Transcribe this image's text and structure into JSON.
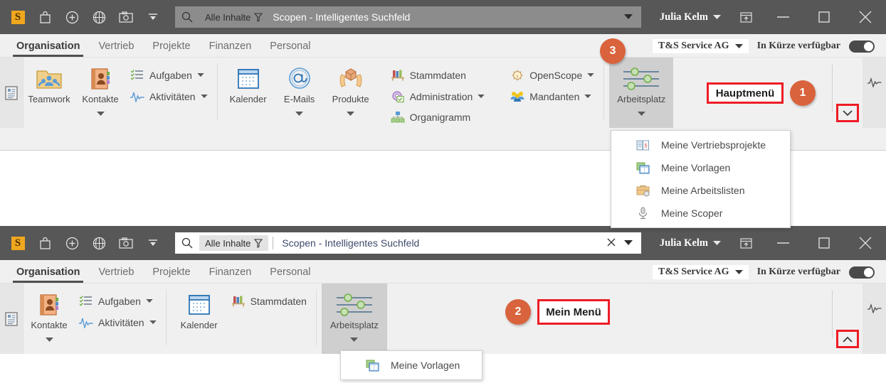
{
  "titlebar": {
    "logo": "S",
    "icons": [
      "shopping-bag-icon",
      "add-circle-icon",
      "globe-icon",
      "camera-icon",
      "overflow-caret-icon"
    ],
    "search_scope": "Alle Inhalte",
    "search_placeholder": "Scopen - Intelligentes Suchfeld",
    "search_value": "Scopen - Intelligentes Suchfeld",
    "user": "Julia Kelm",
    "minimize": "—",
    "maximize": "□",
    "close": "✕"
  },
  "tabbar": {
    "tabs": [
      {
        "label": "Organisation",
        "active": true
      },
      {
        "label": "Vertrieb",
        "active": false
      },
      {
        "label": "Projekte",
        "active": false
      },
      {
        "label": "Finanzen",
        "active": false
      },
      {
        "label": "Personal",
        "active": false
      }
    ],
    "org": "T&S Service AG",
    "availability": "In Kürze verfügbar"
  },
  "ribbon1": {
    "big": [
      {
        "label": "Teamwork",
        "icon": "teamwork-folder-icon",
        "caret": false
      },
      {
        "label": "Kontakte",
        "icon": "contacts-book-icon",
        "caret": true
      },
      {
        "label": "Kalender",
        "icon": "calendar-icon",
        "caret": false
      },
      {
        "label": "E-Mails",
        "icon": "at-sign-icon",
        "caret": true
      },
      {
        "label": "Produkte",
        "icon": "product-box-icon",
        "caret": true
      },
      {
        "label": "Arbeitsplatz",
        "icon": "workplace-sliders-icon",
        "caret": true
      }
    ],
    "small_group_a": [
      {
        "label": "Aufgaben",
        "icon": "tasks-list-icon",
        "caret": true
      },
      {
        "label": "Aktivitäten",
        "icon": "activity-pulse-icon",
        "caret": true
      }
    ],
    "small_group_b": [
      {
        "label": "Stammdaten",
        "icon": "masterdata-books-icon",
        "caret": false
      },
      {
        "label": "Administration",
        "icon": "administration-gear-icon",
        "caret": true
      },
      {
        "label": "Organigramm",
        "icon": "orgchart-icon",
        "caret": false
      }
    ],
    "small_group_c": [
      {
        "label": "OpenScope",
        "icon": "openscope-icon",
        "caret": true
      },
      {
        "label": "Mandanten",
        "icon": "clients-people-icon",
        "caret": true
      }
    ]
  },
  "ribbon2": {
    "big": [
      {
        "label": "Kontakte",
        "icon": "contacts-book-icon",
        "caret": true
      },
      {
        "label": "Kalender",
        "icon": "calendar-icon",
        "caret": false
      },
      {
        "label": "Arbeitsplatz",
        "icon": "workplace-sliders-icon",
        "caret": true
      }
    ],
    "small_group_a": [
      {
        "label": "Aufgaben",
        "icon": "tasks-list-icon",
        "caret": true
      },
      {
        "label": "Aktivitäten",
        "icon": "activity-pulse-icon",
        "caret": true
      }
    ],
    "small_group_b": [
      {
        "label": "Stammdaten",
        "icon": "masterdata-books-icon",
        "caret": false
      }
    ]
  },
  "dropdown1": {
    "items": [
      {
        "label": "Meine Vertriebsprojekte",
        "icon": "sales-projects-icon"
      },
      {
        "label": "Meine Vorlagen",
        "icon": "templates-icon"
      },
      {
        "label": "Meine Arbeitslisten",
        "icon": "worklists-briefcase-icon"
      },
      {
        "label": "Meine Scoper",
        "icon": "scoper-microphone-icon"
      }
    ]
  },
  "dropdown2": {
    "items": [
      {
        "label": "Meine Vorlagen",
        "icon": "templates-icon"
      }
    ]
  },
  "callouts": {
    "one": {
      "badge": "1",
      "label": "Hauptmenü"
    },
    "two": {
      "badge": "2",
      "label": "Mein Menü"
    },
    "three": {
      "badge": "3"
    }
  },
  "colors": {
    "titlebar_bg": "#575757",
    "ribbon_bg": "#f0f0f0",
    "accent_red": "#ee1c25",
    "badge_orange": "#d9633c",
    "logo_orange": "#f0a71e",
    "selected_gray": "#cfcfcf"
  }
}
